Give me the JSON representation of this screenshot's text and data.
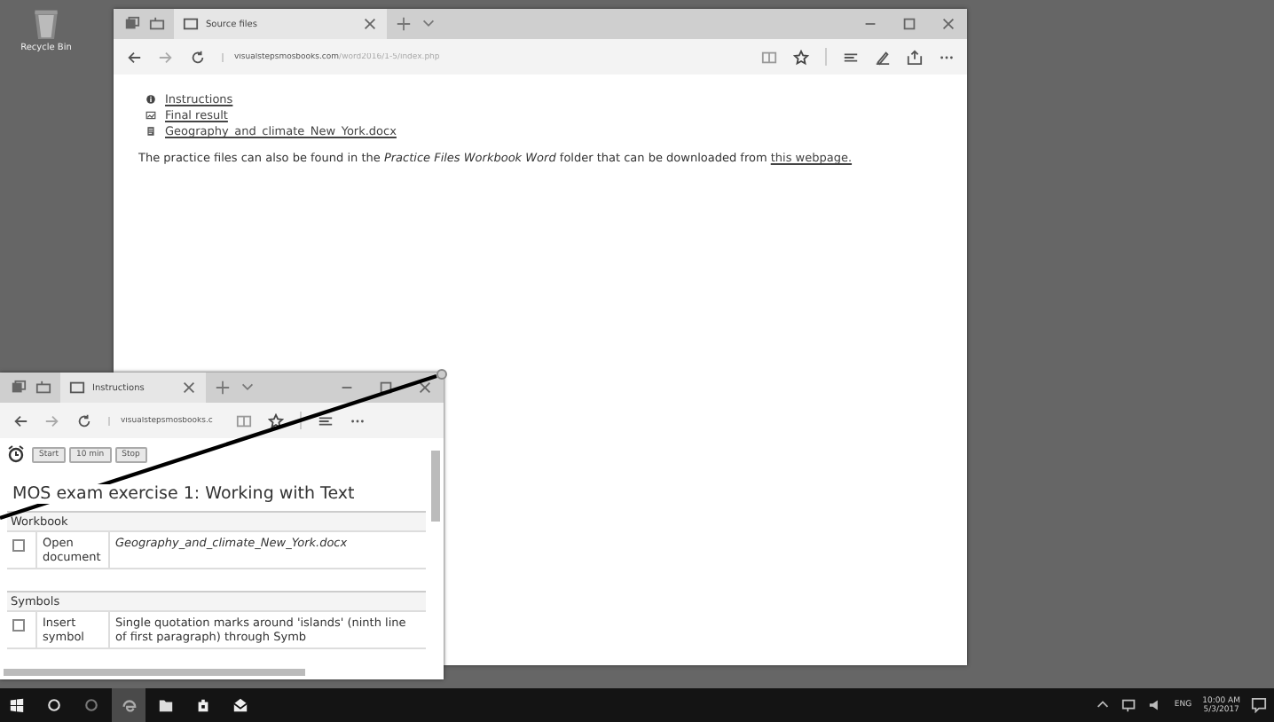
{
  "desktop": {
    "icons": [
      {
        "kind": "recycle",
        "label": "Recycle Bin"
      }
    ]
  },
  "main_window": {
    "tabs": [
      {
        "label": "Source files",
        "selected": true
      }
    ],
    "address": {
      "host": "visualstepsmosbooks.com",
      "path": "/word2016/1-5/index.php"
    },
    "links": [
      {
        "kind": "info",
        "label": "Instructions"
      },
      {
        "kind": "image",
        "label": "Final result"
      },
      {
        "kind": "document",
        "label": "Geography_and_climate_New_York.docx"
      }
    ],
    "note": "The practice files can also be found in the *Practice Files Workbook Word* folder that can be downloaded from",
    "note_link": "this webpage."
  },
  "small_window": {
    "tabs": [
      {
        "label": "Instructions",
        "selected": true
      }
    ],
    "address": {
      "host": "visualstepsmosbooks.c"
    },
    "timer_buttons": [
      "Start",
      "10 min",
      "Stop"
    ],
    "heading": "MOS exam exercise 1: Working with Text",
    "sections": [
      {
        "title": "Workbook",
        "rows": [
          {
            "kind": "file",
            "checked": false,
            "action": "Open document",
            "detail": "Geography_and_climate_New_York.docx"
          }
        ]
      },
      {
        "title": "Symbols",
        "rows": [
          {
            "kind": "text",
            "checked": false,
            "action": "Insert symbol",
            "detail": "Single quotation marks around 'islands' (ninth line of first paragraph) through Symb"
          }
        ]
      }
    ]
  },
  "taskbar": {
    "apps": [
      {
        "kind": "start",
        "selected": false
      },
      {
        "kind": "search",
        "selected": false
      },
      {
        "kind": "taskview",
        "selected": false
      },
      {
        "kind": "edge",
        "selected": true
      },
      {
        "kind": "folder",
        "selected": false
      },
      {
        "kind": "store",
        "selected": false
      },
      {
        "kind": "mail",
        "selected": false
      }
    ],
    "language": "ENG",
    "time": "10:00 AM",
    "date": "5/3/2017"
  }
}
